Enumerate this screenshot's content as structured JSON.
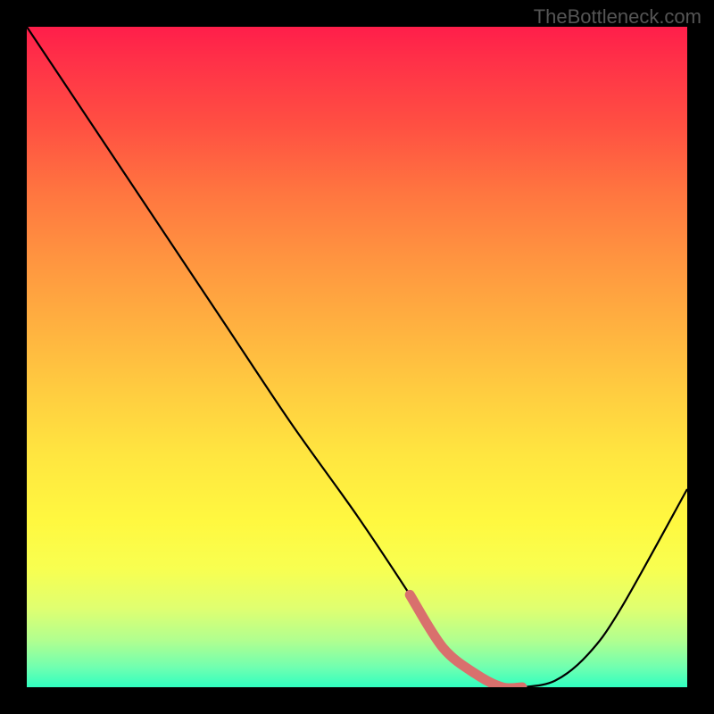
{
  "watermark": "TheBottleneck.com",
  "chart_data": {
    "type": "line",
    "title": "",
    "xlabel": "",
    "ylabel": "",
    "xlim": [
      0,
      100
    ],
    "ylim": [
      0,
      100
    ],
    "curve": {
      "x": [
        0,
        10,
        20,
        30,
        40,
        50,
        58,
        63,
        68,
        72,
        75,
        80,
        85,
        90,
        100
      ],
      "y": [
        100,
        85,
        70,
        55,
        40,
        26,
        14,
        6,
        2,
        0,
        0,
        1,
        5,
        12,
        30
      ]
    },
    "highlight_segment": {
      "x": [
        58,
        63,
        68,
        72,
        75
      ],
      "y": [
        14,
        6,
        2,
        0,
        0
      ]
    },
    "gradient_colors": {
      "top": "#ff1e4a",
      "middle": "#ffe640",
      "bottom": "#30ffc0"
    },
    "highlight_color": "#d9706d"
  }
}
